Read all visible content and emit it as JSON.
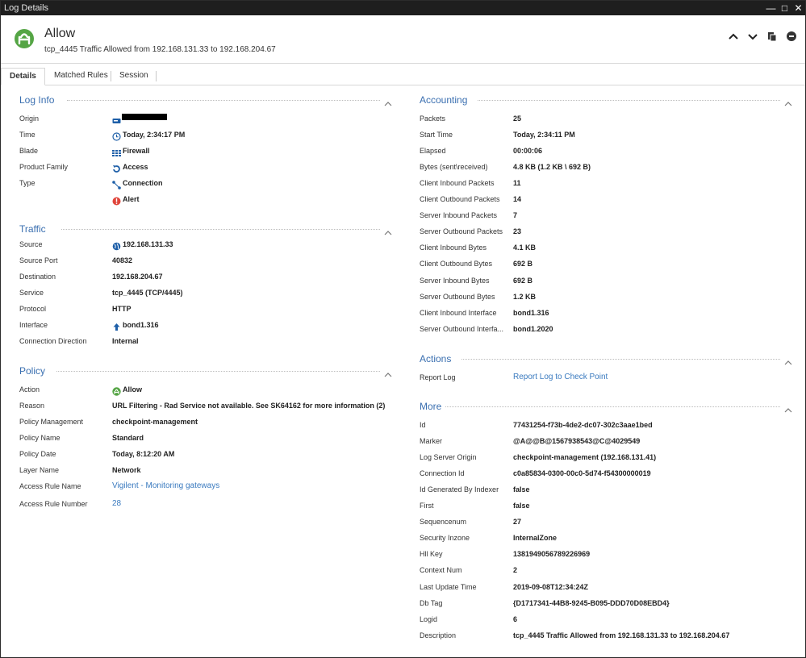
{
  "window": {
    "title": "Log Details"
  },
  "header": {
    "title": "Allow",
    "subtitle": "tcp_4445 Traffic Allowed from 192.168.131.33 to 192.168.204.67"
  },
  "tabs": [
    "Details",
    "Matched Rules",
    "Session"
  ],
  "log_info": {
    "title": "Log Info",
    "rows": [
      {
        "label": "Origin",
        "value": "",
        "icon": "gateway-icon"
      },
      {
        "label": "Time",
        "value": "Today, 2:34:17 PM",
        "icon": "clock-icon"
      },
      {
        "label": "Blade",
        "value": "Firewall",
        "icon": "firewall-icon"
      },
      {
        "label": "Product Family",
        "value": "Access",
        "icon": "access-icon"
      },
      {
        "label": "Type",
        "value": "Connection",
        "icon": "connection-icon"
      },
      {
        "label": "",
        "value": "Alert",
        "icon": "alert-icon"
      }
    ]
  },
  "traffic": {
    "title": "Traffic",
    "rows": [
      {
        "label": "Source",
        "value": "192.168.131.33",
        "icon": "globe-icon"
      },
      {
        "label": "Source Port",
        "value": "40832"
      },
      {
        "label": "Destination",
        "value": "192.168.204.67"
      },
      {
        "label": "Service",
        "value": "tcp_4445 (TCP/4445)"
      },
      {
        "label": "Protocol",
        "value": "HTTP"
      },
      {
        "label": "Interface",
        "value": "bond1.316",
        "icon": "upload-arrow-icon"
      },
      {
        "label": "Connection Direction",
        "value": "Internal"
      }
    ]
  },
  "policy": {
    "title": "Policy",
    "rows": [
      {
        "label": "Action",
        "value": "Allow",
        "icon": "allow-icon"
      },
      {
        "label": "Reason",
        "value": "URL Filtering  -  Rad Service not available. See SK64162 for more information (2)"
      },
      {
        "label": "Policy Management",
        "value": "checkpoint-management"
      },
      {
        "label": "Policy Name",
        "value": "Standard"
      },
      {
        "label": "Policy Date",
        "value": "Today, 8:12:20 AM"
      },
      {
        "label": "Layer Name",
        "value": "Network"
      },
      {
        "label": "Access Rule Name",
        "value": "Vigilent - Monitoring gateways",
        "link": true
      },
      {
        "label": "Access Rule Number",
        "value": "28",
        "link": true
      }
    ]
  },
  "accounting": {
    "title": "Accounting",
    "rows": [
      {
        "label": "Packets",
        "value": "25"
      },
      {
        "label": "Start Time",
        "value": "Today, 2:34:11 PM"
      },
      {
        "label": "Elapsed",
        "value": "00:00:06"
      },
      {
        "label": "Bytes (sent\\received)",
        "value": "4.8 KB (1.2 KB \\ 692 B)"
      },
      {
        "label": "Client Inbound Packets",
        "value": "11"
      },
      {
        "label": "Client Outbound Packets",
        "value": "14"
      },
      {
        "label": "Server Inbound Packets",
        "value": "7"
      },
      {
        "label": "Server Outbound Packets",
        "value": "23"
      },
      {
        "label": "Client Inbound Bytes",
        "value": "4.1 KB"
      },
      {
        "label": "Client Outbound Bytes",
        "value": "692 B"
      },
      {
        "label": "Server Inbound Bytes",
        "value": "692 B"
      },
      {
        "label": "Server Outbound Bytes",
        "value": "1.2 KB"
      },
      {
        "label": "Client Inbound Interface",
        "value": "bond1.316"
      },
      {
        "label": "Server Outbound Interfa...",
        "value": "bond1.2020"
      }
    ]
  },
  "actions": {
    "title": "Actions",
    "rows": [
      {
        "label": "Report Log",
        "value": "Report Log to Check Point",
        "link": true
      }
    ]
  },
  "more": {
    "title": "More",
    "rows": [
      {
        "label": "Id",
        "value": "77431254-f73b-4de2-dc07-302c3aae1bed"
      },
      {
        "label": "Marker",
        "value": "@A@@B@1567938543@C@4029549"
      },
      {
        "label": "Log Server Origin",
        "value": "checkpoint-management (192.168.131.41)"
      },
      {
        "label": "Connection Id",
        "value": "c0a85834-0300-00c0-5d74-f54300000019"
      },
      {
        "label": "Id Generated By Indexer",
        "value": "false"
      },
      {
        "label": "First",
        "value": "false"
      },
      {
        "label": "Sequencenum",
        "value": "27"
      },
      {
        "label": "Security Inzone",
        "value": "InternalZone"
      },
      {
        "label": "Hll Key",
        "value": "1381949056789226969"
      },
      {
        "label": "Context Num",
        "value": "2"
      },
      {
        "label": "Last Update Time",
        "value": "2019-09-08T12:34:24Z"
      },
      {
        "label": "Db Tag",
        "value": "{D1717341-44B8-9245-B095-DDD70D08EBD4}"
      },
      {
        "label": "Logid",
        "value": "6"
      },
      {
        "label": "Description",
        "value": "tcp_4445 Traffic Allowed from 192.168.131.33 to 192.168.204.67"
      }
    ]
  },
  "colors": {
    "section_title": "#3a6fb0",
    "allow_green": "#55a545",
    "link": "#3a7abf",
    "alert_red": "#e0463c"
  }
}
